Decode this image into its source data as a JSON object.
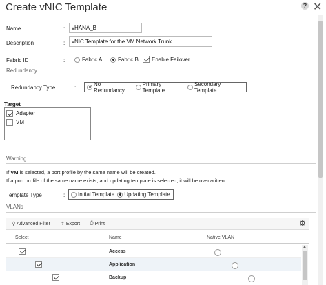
{
  "dialog": {
    "title": "Create vNIC Template",
    "help": "?",
    "close": "✕"
  },
  "form": {
    "name_label": "Name",
    "name_value": "vHANA_B",
    "description_label": "Description",
    "description_value": "vNIC Template for the VM Network Trunk",
    "fabric_label": "Fabric ID",
    "fabric_a": "Fabric A",
    "fabric_b": "Fabric B",
    "fabric_selected": "Fabric B",
    "failover_label": "Enable Failover",
    "failover_checked": true,
    "colon": ":"
  },
  "redundancy": {
    "section": "Redundancy",
    "type_label": "Redundancy Type",
    "options": [
      "No Redundancy",
      "Primary Template",
      "Secondary Template"
    ],
    "selected": "No Redundancy"
  },
  "target": {
    "section": "Target",
    "items": [
      {
        "label": "Adapter",
        "checked": true
      },
      {
        "label": "VM",
        "checked": false
      }
    ]
  },
  "warning": {
    "section": "Warning",
    "line1_prefix": "If ",
    "line1_bold": "VM",
    "line1_suffix": " is selected, a port profile by the same name will be created.",
    "line2": "If a port profile of the same name exists, and updating template is selected, it will be overwritten"
  },
  "template_type": {
    "label": "Template Type",
    "options": [
      "Initial Template",
      "Updating Template"
    ],
    "selected": "Updating Template"
  },
  "vlans": {
    "section": "VLANs",
    "toolbar": {
      "advanced_filter": "Advanced Filter",
      "export": "Export",
      "print": "Print"
    },
    "columns": {
      "select": "Select",
      "name": "Name",
      "native": "Native VLAN"
    },
    "rows": [
      {
        "name": "Access",
        "checked": true,
        "native": false
      },
      {
        "name": "Application",
        "checked": true,
        "native": false
      },
      {
        "name": "Backup",
        "checked": true,
        "native": false
      }
    ]
  }
}
